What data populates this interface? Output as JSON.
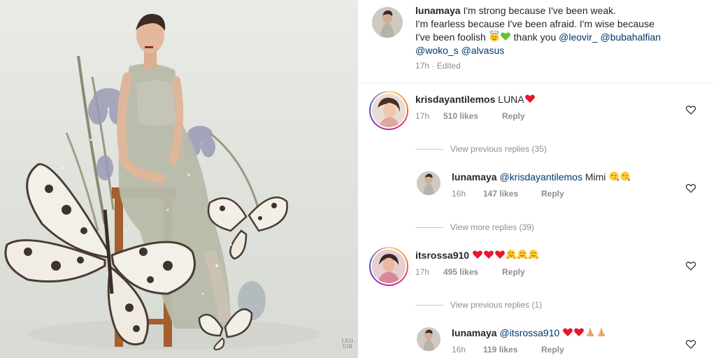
{
  "photo": {
    "watermark_line1": "LEO",
    "watermark_line2": "VIR"
  },
  "post": {
    "username": "lunamaya",
    "caption_line1": "I'm strong because I've been weak.",
    "caption_line2": "I'm fearless because I've been afraid.  I'm wise because",
    "caption_line3_text": "I've been foolish",
    "caption_line3_emojis": [
      "smiling-face-with-halo",
      "green-heart"
    ],
    "caption_thanks": "thank you",
    "mentions": [
      "@leovir_",
      "@bubahalfian",
      "@woko_s",
      "@alvasus"
    ],
    "time": "17h",
    "edited": "Edited",
    "separator": "·"
  },
  "comments": [
    {
      "username": "krisdayantilemos",
      "text": "LUNA",
      "emojis": [
        "red-heart"
      ],
      "time": "17h",
      "likes": "510 likes",
      "reply_label": "Reply",
      "view_replies": "View previous replies (35)",
      "reply": {
        "username": "lunamaya",
        "mention": "@krisdayantilemos",
        "text": "Mimi",
        "emojis": [
          "face-blowing-kiss",
          "face-blowing-kiss"
        ],
        "time": "16h",
        "likes": "147 likes",
        "reply_label": "Reply"
      },
      "view_more": "View more replies (39)"
    },
    {
      "username": "itsrossa910",
      "emojis": [
        "red-heart",
        "red-heart",
        "red-heart",
        "hugging-face",
        "hugging-face",
        "hugging-face"
      ],
      "time": "17h",
      "likes": "495 likes",
      "reply_label": "Reply",
      "view_replies": "View previous replies (1)",
      "reply": {
        "username": "lunamaya",
        "mention": "@itsrossa910",
        "emojis": [
          "red-heart",
          "red-heart",
          "folded-hands",
          "folded-hands"
        ],
        "time": "16h",
        "likes": "119 likes",
        "reply_label": "Reply"
      }
    }
  ],
  "icons": {
    "like": "heart-outline-icon"
  },
  "colors": {
    "mention": "#00376b",
    "meta": "#8e8e8e",
    "text": "#262626"
  }
}
